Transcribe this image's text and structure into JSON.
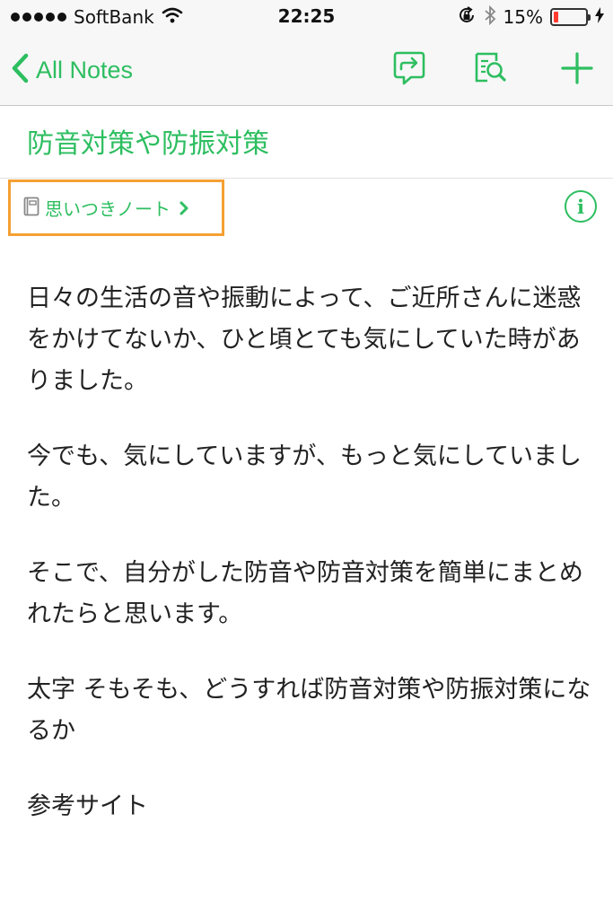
{
  "status_bar": {
    "carrier": "SoftBank",
    "time": "22:25",
    "battery_percent": "15%",
    "battery_level": 0.15
  },
  "nav": {
    "back_label": "All Notes",
    "icons": [
      "share-icon",
      "search-in-note-icon",
      "add-icon"
    ]
  },
  "note": {
    "title": "防音対策や防振対策",
    "notebook": "思いつきノート",
    "paragraphs": [
      "日々の生活の音や振動によって、ご近所さんに迷惑をかけてないか、ひと頃とても気にしていた時がありました。",
      "今でも、気にしていますが、もっと気にしていました。",
      "そこで、自分がした防音や防音対策を簡単にまとめれたらと思います。",
      "太字 そもそも、どうすれば防音対策や防振対策になるか",
      "参考サイト"
    ]
  },
  "colors": {
    "accent": "#2dbe60",
    "highlight_border": "#f5a032",
    "battery_low": "#ff3b30"
  }
}
